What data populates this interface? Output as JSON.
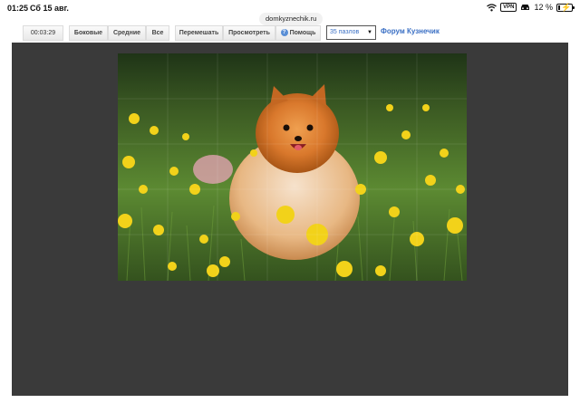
{
  "status": {
    "time": "01:25",
    "date": "Сб 15 авг.",
    "vpn": "VPN",
    "battery": "12 %",
    "battery_level": 0.12
  },
  "browser": {
    "url": "domkyznechik.ru"
  },
  "toolbar": {
    "timer": "00:03:29",
    "side_label": "Боковые",
    "middle_label": "Средние",
    "all_label": "Все",
    "shuffle_label": "Перемешать",
    "view_label": "Просмотреть",
    "help_label": "Помощь",
    "pieces_select": "35 пазлов",
    "forum_link": "Форум Кузнечик"
  },
  "puzzle": {
    "subject": "pomeranian-dog-in-dandelion-field",
    "colors": {
      "board": "#3a3a3a",
      "grass": "#4f7a2e",
      "fur": "#d9782c",
      "flower": "#f2d21a"
    }
  }
}
